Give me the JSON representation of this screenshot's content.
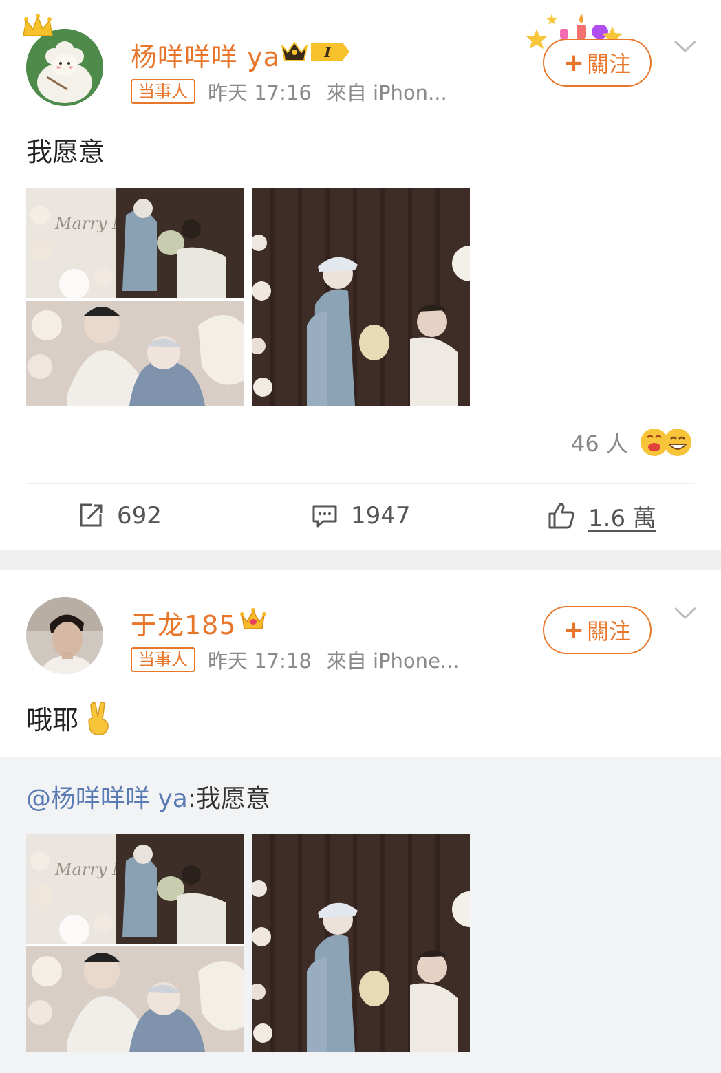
{
  "posts": [
    {
      "author": "杨咩咩咩 ya",
      "badge": "当事人",
      "time": "昨天 17:16",
      "source": "來自 iPhon...",
      "follow_label": "關注",
      "text": "我愿意",
      "reactions_count": "46 人",
      "repost_count": "692",
      "comment_count": "1947",
      "like_count": "1.6 萬"
    },
    {
      "author": "于龙185",
      "badge": "当事人",
      "time": "昨天 17:18",
      "source": "來自 iPhone...",
      "follow_label": "關注",
      "text": "哦耶",
      "quote": {
        "mention": "@杨咩咩咩 ya",
        "text": ":我愿意"
      }
    }
  ],
  "photo_text": "Marry Me",
  "colors": {
    "accent": "#e8762a",
    "mention": "#5a7bb4",
    "quote_bg": "#f2f3f5"
  },
  "icons": [
    "crown-icon",
    "vip-badge-icon",
    "chevron-down-icon",
    "repost-icon",
    "comment-icon",
    "like-icon",
    "emoji-icon",
    "victory-hand-icon"
  ]
}
